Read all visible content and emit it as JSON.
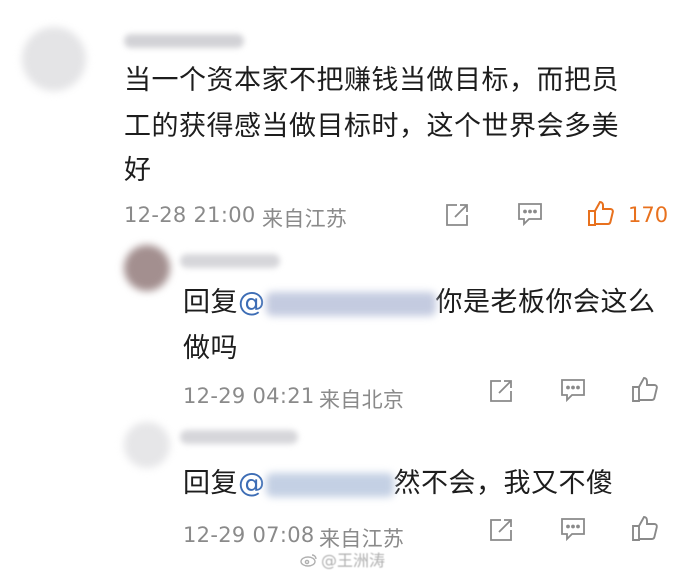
{
  "comment": {
    "text_lines": [
      "当一个资本家不把赚钱当做目标，而把员",
      "工的获得感当做目标时，这个世界会多美",
      "好"
    ],
    "time": "12-28 21:00",
    "location": "来自江苏",
    "like_count": "170",
    "colors": {
      "like": "#e8711e",
      "meta": "#8a8a8a",
      "mention": "#3d6db5"
    }
  },
  "replies": [
    {
      "prefix": "回复",
      "mention": "@",
      "text_after_mask": "你是老板你会这么",
      "text_line2": "做吗",
      "time": "12-29 04:21",
      "location": "来自北京"
    },
    {
      "prefix": "回复",
      "mention": "@",
      "text_after_mask": "然不会，我又不傻",
      "time": "12-29 07:08",
      "location": "来自江苏"
    }
  ],
  "icons": [
    "share-icon",
    "comment-icon",
    "like-icon"
  ],
  "watermark": {
    "text": "@王洲涛"
  }
}
